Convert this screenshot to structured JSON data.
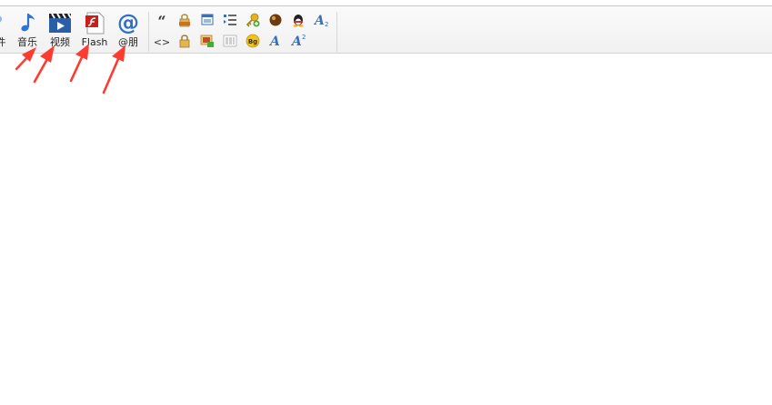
{
  "toolbar": {
    "partial_left_label": "件",
    "buttons": [
      {
        "id": "music",
        "label": "音乐",
        "icon": "music-note-icon"
      },
      {
        "id": "video",
        "label": "视频",
        "icon": "film-clapper-icon"
      },
      {
        "id": "flash",
        "label": "Flash",
        "icon": "flash-document-icon"
      },
      {
        "id": "mention",
        "label": "@朋",
        "icon": "at-sign-icon"
      }
    ],
    "small_icons_row1": [
      "quote-icon",
      "free-lock-icon",
      "window-icon",
      "list-indent-icon",
      "key-plus-icon",
      "ball-icon",
      "qq-penguin-icon",
      "subscript-icon"
    ],
    "small_icons_row2": [
      "code-icon",
      "lock-icon",
      "picture-frame-icon",
      "columns-icon",
      "bg-color-icon",
      "italic-a-icon",
      "superscript-icon"
    ],
    "subscript_mark": "2",
    "superscript_mark": "2",
    "bg_badge": "Bg",
    "quote_glyph": "“",
    "code_glyph": "<>"
  },
  "annotations": {
    "arrow_color": "#ff3b2f",
    "arrow_count": 4
  }
}
